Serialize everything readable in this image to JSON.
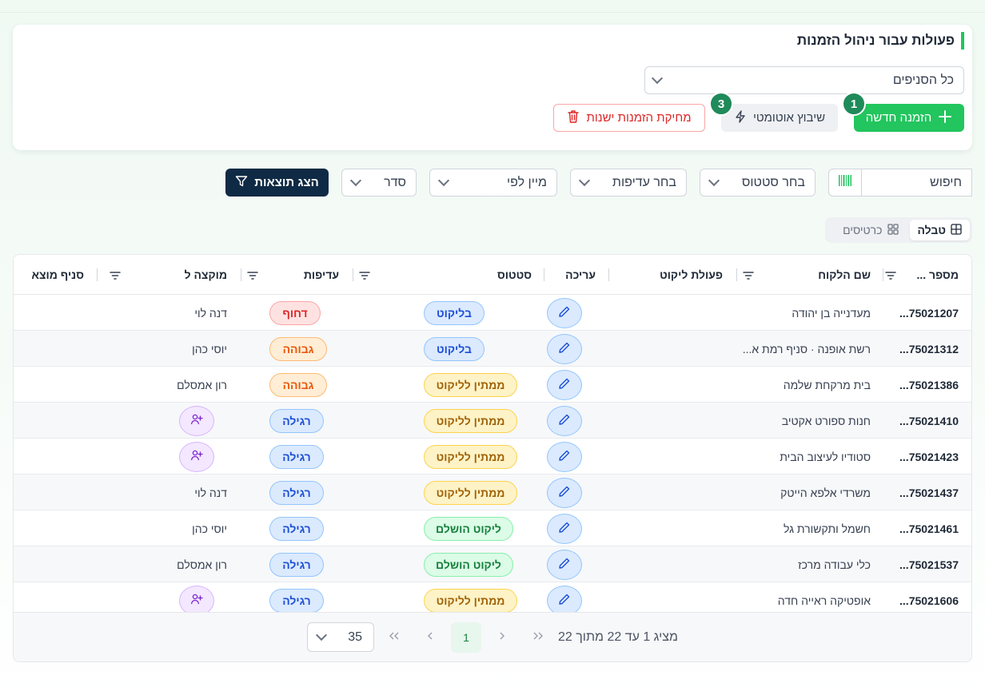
{
  "card": {
    "title": "פעולות עבור ניהול הזמנות",
    "branch_select": "כל הסניפים",
    "new_order": "הזמנה חדשה",
    "new_order_badge": "1",
    "auto_assign": "שיבוץ אוטומטי",
    "auto_assign_badge": "3",
    "delete_old": "מחיקת הזמנות ישנות"
  },
  "filters": {
    "search_placeholder": "חיפוש",
    "status": "בחר סטטוס",
    "priority": "בחר עדיפות",
    "sort_by": "מיין לפי",
    "order": "סדר",
    "show_results": "הצג תוצאות"
  },
  "view_toggle": {
    "table": "טבלה",
    "cards": "כרטיסים",
    "active": "table"
  },
  "table": {
    "columns": {
      "order_no": "מספר ...",
      "customer": "שם הלקוח",
      "pick_action": "פעולת ליקוט",
      "edit": "עריכה",
      "status": "סטטוס",
      "priority": "עדיפות",
      "assigned": "מוקצה ל",
      "source_branch": "סניף מוצא"
    },
    "rows": [
      {
        "order_no": "75021207...",
        "customer": "מעדנייה בן יהודה",
        "status": "בליקוט",
        "status_color": "blue",
        "priority": "דחוף",
        "priority_color": "red",
        "assigned": "דנה לוי"
      },
      {
        "order_no": "75021312...",
        "customer": "רשת אופנה · סניף רמת א...",
        "status": "בליקוט",
        "status_color": "blue",
        "priority": "גבוהה",
        "priority_color": "orange",
        "assigned": "יוסי כהן"
      },
      {
        "order_no": "75021386...",
        "customer": "בית מרקחת שלמה",
        "status": "ממתין לליקוט",
        "status_color": "yellow",
        "priority": "גבוהה",
        "priority_color": "orange",
        "assigned": "רון אמסלם"
      },
      {
        "order_no": "75021410...",
        "customer": "חנות ספורט אקטיב",
        "status": "ממתין לליקוט",
        "status_color": "yellow",
        "priority": "רגילה",
        "priority_color": "blue",
        "assigned": ""
      },
      {
        "order_no": "75021423...",
        "customer": "סטודיו לעיצוב הבית",
        "status": "ממתין לליקוט",
        "status_color": "yellow",
        "priority": "רגילה",
        "priority_color": "blue",
        "assigned": ""
      },
      {
        "order_no": "75021437...",
        "customer": "משרדי אלפא הייטק",
        "status": "ממתין לליקוט",
        "status_color": "yellow",
        "priority": "רגילה",
        "priority_color": "blue",
        "assigned": "דנה לוי"
      },
      {
        "order_no": "75021461...",
        "customer": "חשמל ותקשורת גל",
        "status": "ליקוט הושלם",
        "status_color": "green",
        "priority": "רגילה",
        "priority_color": "blue",
        "assigned": "יוסי כהן"
      },
      {
        "order_no": "75021537...",
        "customer": "כלי עבודה מרכז",
        "status": "ליקוט הושלם",
        "status_color": "green",
        "priority": "רגילה",
        "priority_color": "blue",
        "assigned": "רון אמסלם"
      },
      {
        "order_no": "75021606...",
        "customer": "אופטיקה ראייה חדה",
        "status": "ממתין לליקוט",
        "status_color": "yellow",
        "priority": "רגילה",
        "priority_color": "blue",
        "assigned": ""
      }
    ]
  },
  "pagination": {
    "summary": "מציג 1 עד 22 מתוך 22",
    "current_page": "1",
    "page_size": "35"
  },
  "colors": {
    "primary_green": "#22c55e",
    "dark_navy": "#0f2a44",
    "badge_green": "#1f8a5a",
    "danger_red": "#dc2626"
  }
}
